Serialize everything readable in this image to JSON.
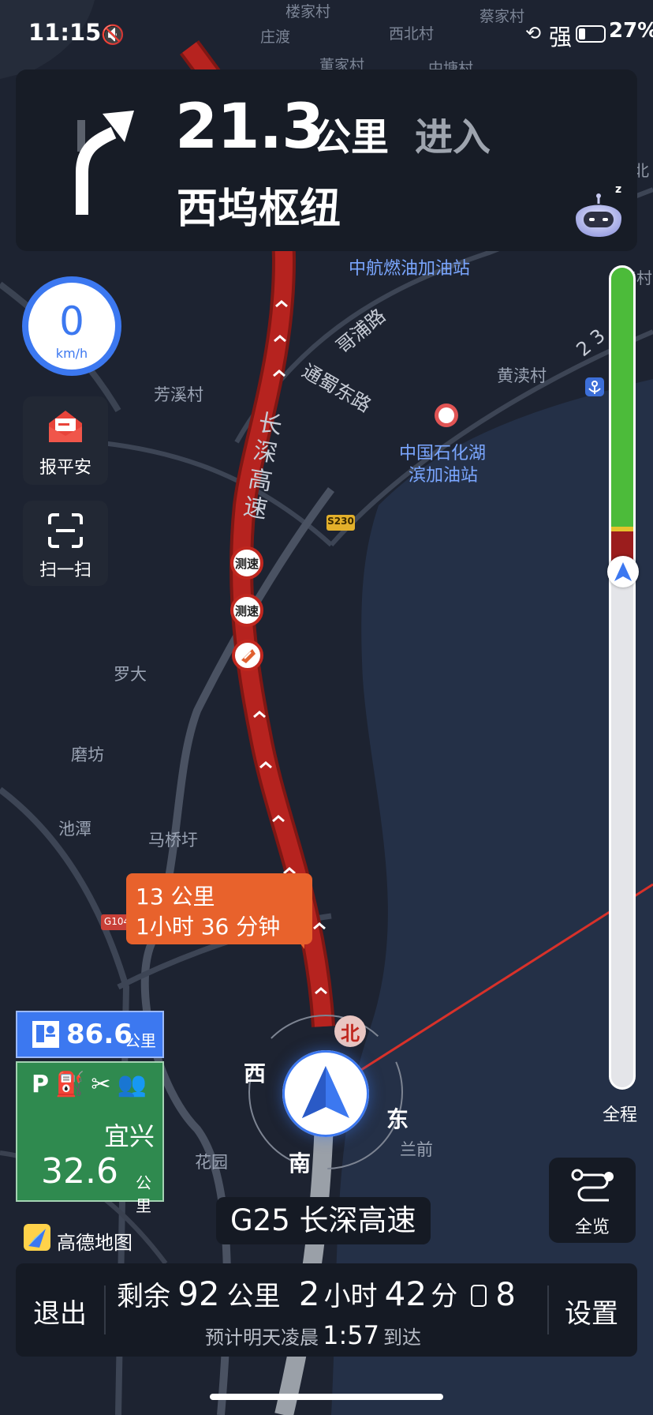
{
  "status_bar": {
    "time": "11:15",
    "signal_label": "强",
    "battery": "27%"
  },
  "navigation": {
    "distance_value": "21.3",
    "distance_unit": "公里",
    "action": "进入",
    "destination": "西坞枢纽",
    "speed_value": "0",
    "speed_unit": "km/h"
  },
  "left_controls": {
    "report_safe": "报平安",
    "scan": "扫一扫"
  },
  "map_labels": {
    "places": [
      "楼家村",
      "庄渡",
      "西北村",
      "董家村",
      "中塘村",
      "蔡家村",
      "中航燃油加油站",
      "芳溪村",
      "黄渎村",
      "罗大",
      "磨坊",
      "池潭",
      "马桥圩",
      "花园",
      "兰前",
      "中国石化湖",
      "滨加油站"
    ],
    "roads": [
      "长深高速",
      "哥浦路",
      "通蜀东路",
      "2 3"
    ],
    "road_shields": [
      "S230",
      "G104"
    ],
    "camera": "测速",
    "misc_right": [
      "北",
      "渎村"
    ]
  },
  "callout": {
    "distance": "13 公里",
    "time": "1小时 36 分钟"
  },
  "compass": {
    "north": "北",
    "south": "南",
    "east": "东",
    "west": "西"
  },
  "service_panel": {
    "next_distance": "86.6",
    "next_unit": "公里",
    "name": "宜兴",
    "distance": "32.6",
    "unit": "公里"
  },
  "progress": {
    "label": "全程",
    "traveled_fraction": 0.36
  },
  "brand": "高德地图",
  "overview_button": "全览",
  "current_road": "G25 长深高速",
  "summary": {
    "exit": "退出",
    "remaining_label": "剩余",
    "remaining_km": "92",
    "km_unit": "公里",
    "hours": "2",
    "hours_unit": "小时",
    "minutes": "42",
    "minutes_unit": "分",
    "lights_count": "8",
    "arrival_prefix": "预计明天凌晨",
    "arrival_time": "1:57",
    "arrival_suffix": "到达",
    "settings": "设置"
  },
  "colors": {
    "route": "#b6231f",
    "accent_blue": "#3c78f0",
    "traffic_green": "#4cbb3a",
    "service_green": "#2f8a4f",
    "callout_orange": "#e8622c"
  }
}
